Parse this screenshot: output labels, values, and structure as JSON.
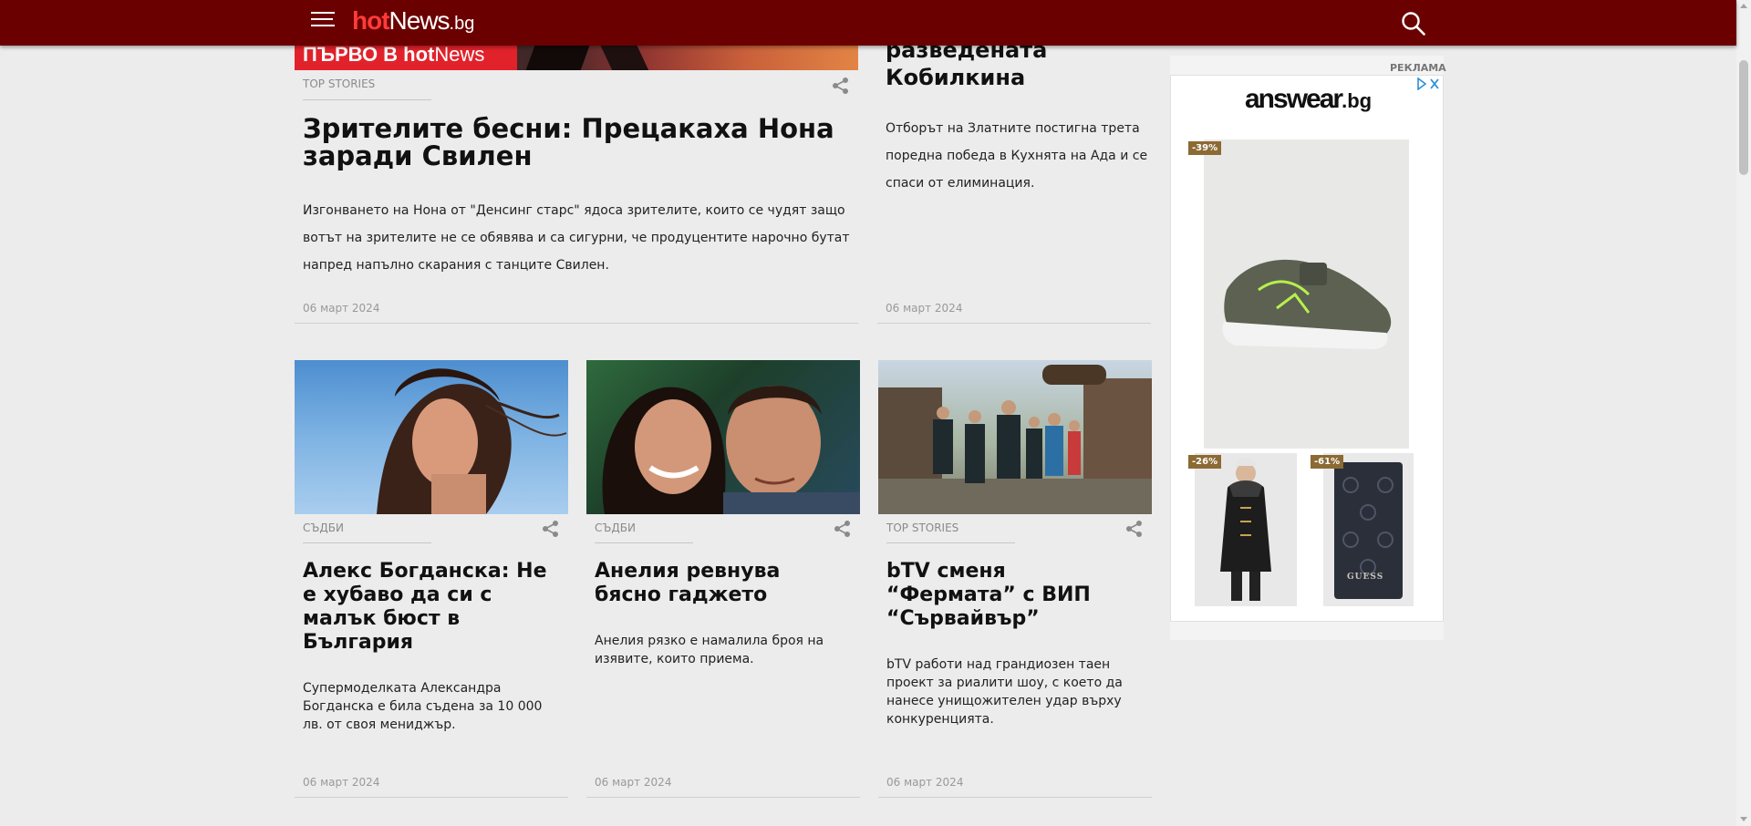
{
  "header": {
    "logo_hot": "hot",
    "logo_news": "News",
    "logo_bg": ".bg",
    "menu_icon": "hamburger-icon",
    "search_icon": "search-icon"
  },
  "colors": {
    "header_bg": "#6b0000",
    "logo_accent": "#ff3b3b",
    "badge_red": "#e2222b",
    "page_bg": "#ececec"
  },
  "articles_top": [
    {
      "badge_prefix": "ПЪРВО В hot",
      "badge_suffix": "News",
      "category": "TOP STORIES",
      "title": "Зрителите бесни: Прецакаха Нона заради Свилен",
      "text": "Изгонването на Нона от \"Денсинг старс\" ядоса зрителите, които се чудят защо вотът на зрителите не се обявява и са сигурни, че продуцентите нарочно бутат напред напълно скарания с танците Свилен.",
      "date": "06 март 2024"
    },
    {
      "title_part1": "разведената",
      "title_part2": "Кобилкина",
      "text": "Отборът на Златните постигна трета поредна победа в Кухнята на Ада и се спаси от елиминация.",
      "date": "06 март 2024"
    }
  ],
  "articles_row": [
    {
      "category": "СЪДБИ",
      "title": "Алекс Богданска: Не е хубаво да си с малък бюст в България",
      "text": "Супермоделката Александра Богданска е била съдена за 10 000 лв. от своя мениджър.",
      "date": "06 март 2024"
    },
    {
      "category": "СЪДБИ",
      "title": "Анелия ревнува бясно гаджето",
      "text": "Анелия рязко е намалила броя на изявите, които приема.",
      "date": "06 март 2024"
    },
    {
      "category": "TOP STORIES",
      "title": "bTV сменя “Фермата” с ВИП “Сървайвър”",
      "text": "bTV работи над грандиозен таен проект за риалити шоу, с което да нанесе унищожителен удар върху конкуренцията.",
      "date": "06 март 2024"
    }
  ],
  "share_icon": "share-icon",
  "ad": {
    "label": "РЕКЛАМА",
    "brand": "answear",
    "brand_suffix": ".bg",
    "discounts": [
      "-39%",
      "-26%",
      "-61%"
    ],
    "product_text": "GUESS",
    "adchoices_icon": "adchoices-icon",
    "close_icon": "close-icon"
  }
}
